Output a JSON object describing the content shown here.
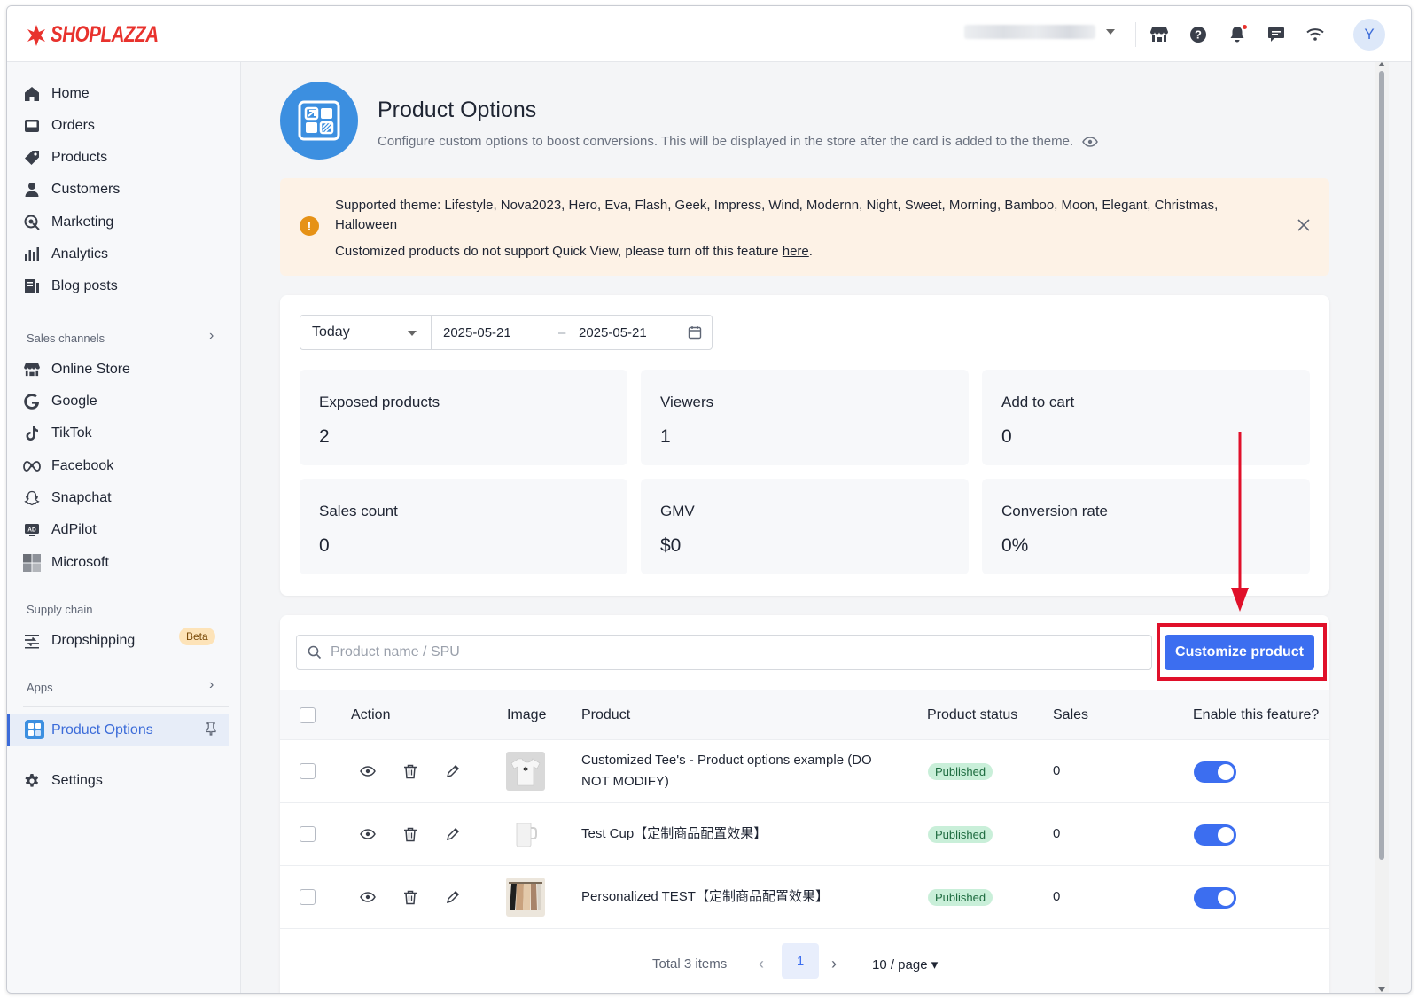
{
  "brand": {
    "name": "SHOPLAZZA",
    "color": "#e8322d"
  },
  "topbar": {
    "store_selector_value": "",
    "icons": [
      "store-icon",
      "help-icon",
      "bell-icon",
      "chat-icon",
      "wifi-icon"
    ],
    "avatar_initial": "Y"
  },
  "sidebar": {
    "items": [
      {
        "label": "Home",
        "icon": "home-icon"
      },
      {
        "label": "Orders",
        "icon": "orders-icon"
      },
      {
        "label": "Products",
        "icon": "tag-icon"
      },
      {
        "label": "Customers",
        "icon": "user-icon"
      },
      {
        "label": "Marketing",
        "icon": "marketing-icon"
      },
      {
        "label": "Analytics",
        "icon": "analytics-icon"
      },
      {
        "label": "Blog posts",
        "icon": "blog-icon"
      }
    ],
    "sales_channels_label": "Sales channels",
    "channels": [
      {
        "label": "Online Store",
        "icon": "store-icon"
      },
      {
        "label": "Google",
        "icon": "google-icon"
      },
      {
        "label": "TikTok",
        "icon": "tiktok-icon"
      },
      {
        "label": "Facebook",
        "icon": "meta-icon"
      },
      {
        "label": "Snapchat",
        "icon": "snapchat-icon"
      },
      {
        "label": "AdPilot",
        "icon": "adpilot-icon"
      },
      {
        "label": "Microsoft",
        "icon": "microsoft-icon"
      }
    ],
    "supply_chain_label": "Supply chain",
    "dropshipping_label": "Dropshipping",
    "beta_label": "Beta",
    "apps_label": "Apps",
    "active_app_label": "Product Options",
    "settings_label": "Settings"
  },
  "page": {
    "title": "Product Options",
    "description": "Configure custom options to boost conversions. This will be displayed in the store after the card is added to the theme."
  },
  "banner": {
    "themes_text": "Supported theme: Lifestyle, Nova2023, Hero, Eva, Flash, Geek, Impress, Wind, Modernn, Night, Sweet, Morning, Bamboo, Moon, Elegant, Christmas, Halloween",
    "notice_text": "Customized products do not support Quick View, please turn off this feature ",
    "notice_link": "here",
    "notice_end": "."
  },
  "filters": {
    "range": "Today",
    "start_date": "2025-05-21",
    "end_date": "2025-05-21",
    "separator": "–"
  },
  "stats": [
    {
      "label": "Exposed products",
      "value": "2"
    },
    {
      "label": "Viewers",
      "value": "1"
    },
    {
      "label": "Add to cart",
      "value": "0"
    },
    {
      "label": "Sales count",
      "value": "0"
    },
    {
      "label": "GMV",
      "value": "$0"
    },
    {
      "label": "Conversion rate",
      "value": "0%"
    }
  ],
  "table": {
    "search_placeholder": "Product name / SPU",
    "search_value": "",
    "customize_button": "Customize product",
    "columns": [
      "Action",
      "Image",
      "Product",
      "Product status",
      "Sales",
      "Enable this feature?"
    ],
    "rows": [
      {
        "product": "Customized Tee's - Product options example (DO NOT MODIFY)",
        "status": "Published",
        "sales": "0",
        "enabled": true,
        "image": "t-shirt"
      },
      {
        "product": "Test Cup【定制商品配置效果】",
        "status": "Published",
        "sales": "0",
        "enabled": true,
        "image": "mug"
      },
      {
        "product": "Personalized TEST【定制商品配置效果】",
        "status": "Published",
        "sales": "0",
        "enabled": true,
        "image": "clothes-rack"
      }
    ]
  },
  "pagination": {
    "total": "Total 3 items",
    "current_page": "1",
    "page_size": "10 / page"
  },
  "colors": {
    "accent": "#3c6ef0",
    "highlight_box": "#e0102a",
    "published_badge": "#c9efd9",
    "banner_bg": "#fdf2e6"
  }
}
